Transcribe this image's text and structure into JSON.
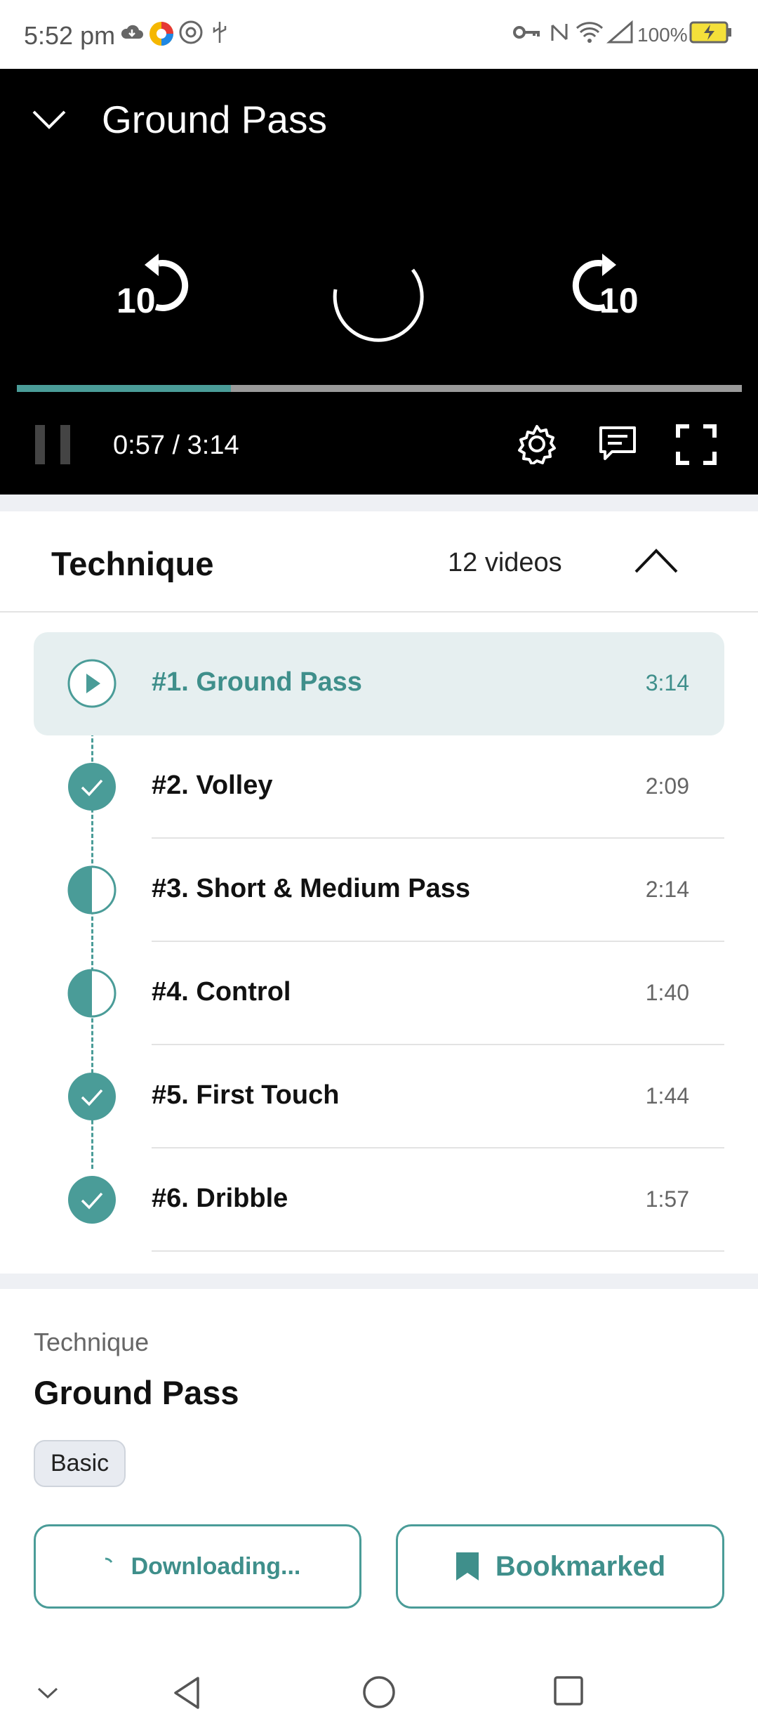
{
  "status_bar": {
    "time": "5:52 pm",
    "battery": "100%",
    "icons": [
      "cloud-icon",
      "color-app-icon",
      "at-icon",
      "usb-icon",
      "key-icon",
      "nfc-icon",
      "wifi-icon",
      "signal-icon",
      "battery-charging-icon"
    ]
  },
  "player": {
    "title": "Ground Pass",
    "rewind_label": "10",
    "forward_label": "10",
    "timecode": "0:57 / 3:14",
    "progress": 0.295,
    "icons": [
      "chevron-down-icon",
      "rewind-10-icon",
      "loading-spinner-icon",
      "forward-10-icon",
      "pause-icon",
      "settings-icon",
      "subtitles-icon",
      "fullscreen-icon"
    ]
  },
  "playlist": {
    "section_title": "Technique",
    "count": "12 videos",
    "items": [
      {
        "label": "#1. Ground Pass",
        "duration": "3:14",
        "state": "playing"
      },
      {
        "label": "#2. Volley",
        "duration": "2:09",
        "state": "completed"
      },
      {
        "label": "#3. Short & Medium Pass",
        "duration": "2:14",
        "state": "partial"
      },
      {
        "label": "#4. Control",
        "duration": "1:40",
        "state": "partial"
      },
      {
        "label": "#5. First Touch",
        "duration": "1:44",
        "state": "completed"
      },
      {
        "label": "#6. Dribble",
        "duration": "1:57",
        "state": "completed"
      }
    ]
  },
  "info": {
    "category": "Technique",
    "title": "Ground Pass",
    "tag": "Basic",
    "download_label": "Downloading...",
    "bookmark_label": "Bookmarked"
  },
  "colors": {
    "accent": "#4a9c98",
    "active_row_bg": "#e6eff0",
    "player_bg": "#000000"
  }
}
